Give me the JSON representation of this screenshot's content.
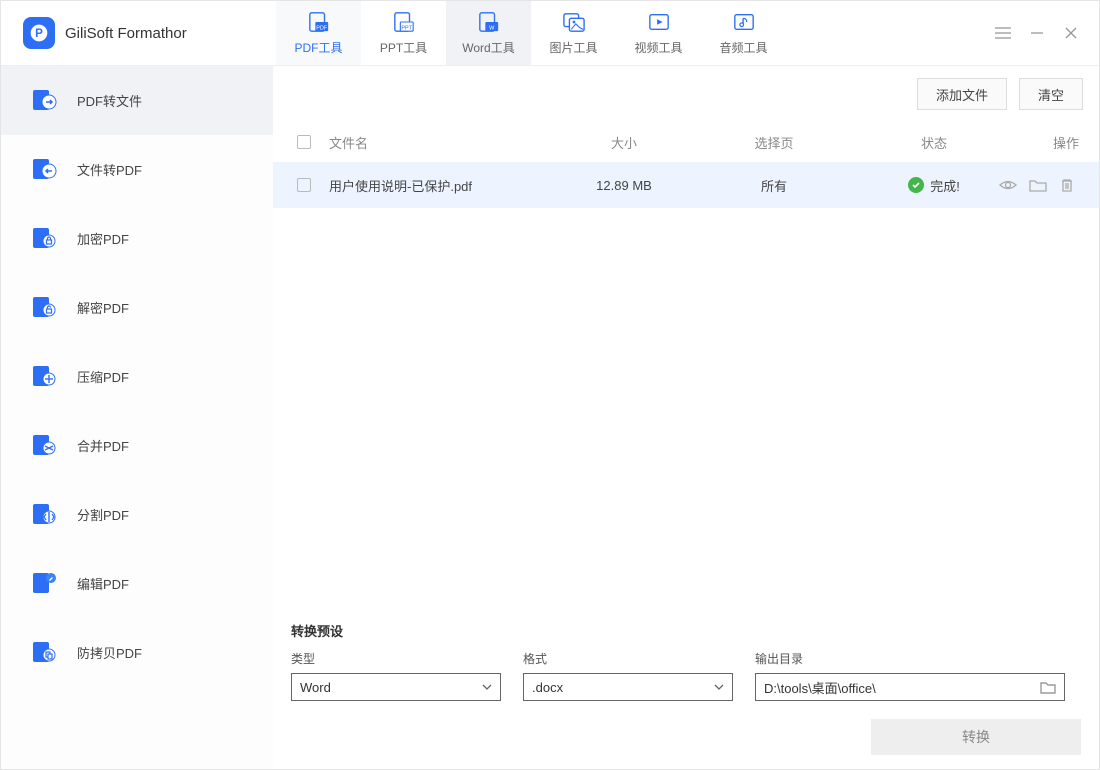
{
  "app": {
    "title": "GiliSoft Formathor"
  },
  "top_tabs": [
    {
      "label": "PDF工具",
      "active": true,
      "type": "pdf"
    },
    {
      "label": "PPT工具",
      "active": false,
      "type": "ppt"
    },
    {
      "label": "Word工具",
      "active": false,
      "type": "word",
      "sub": true
    },
    {
      "label": "图片工具",
      "active": false,
      "type": "image"
    },
    {
      "label": "视频工具",
      "active": false,
      "type": "video"
    },
    {
      "label": "音频工具",
      "active": false,
      "type": "audio"
    }
  ],
  "sidebar": [
    {
      "label": "PDF转文件",
      "active": true
    },
    {
      "label": "文件转PDF",
      "active": false
    },
    {
      "label": "加密PDF",
      "active": false
    },
    {
      "label": "解密PDF",
      "active": false
    },
    {
      "label": "压缩PDF",
      "active": false
    },
    {
      "label": "合并PDF",
      "active": false
    },
    {
      "label": "分割PDF",
      "active": false
    },
    {
      "label": "编辑PDF",
      "active": false
    },
    {
      "label": "防拷贝PDF",
      "active": false
    }
  ],
  "toolbar": {
    "add": "添加文件",
    "clear": "清空"
  },
  "table": {
    "headers": {
      "name": "文件名",
      "size": "大小",
      "pages": "选择页",
      "status": "状态",
      "action": "操作"
    },
    "rows": [
      {
        "name": "用户使用说明-已保护.pdf",
        "size": "12.89 MB",
        "pages": "所有",
        "status": "完成!"
      }
    ]
  },
  "preset": {
    "title": "转换预设",
    "type_label": "类型",
    "type_value": "Word",
    "format_label": "格式",
    "format_value": ".docx",
    "outdir_label": "输出目录",
    "outdir_value": "D:\\tools\\桌面\\office\\",
    "convert": "转换"
  }
}
